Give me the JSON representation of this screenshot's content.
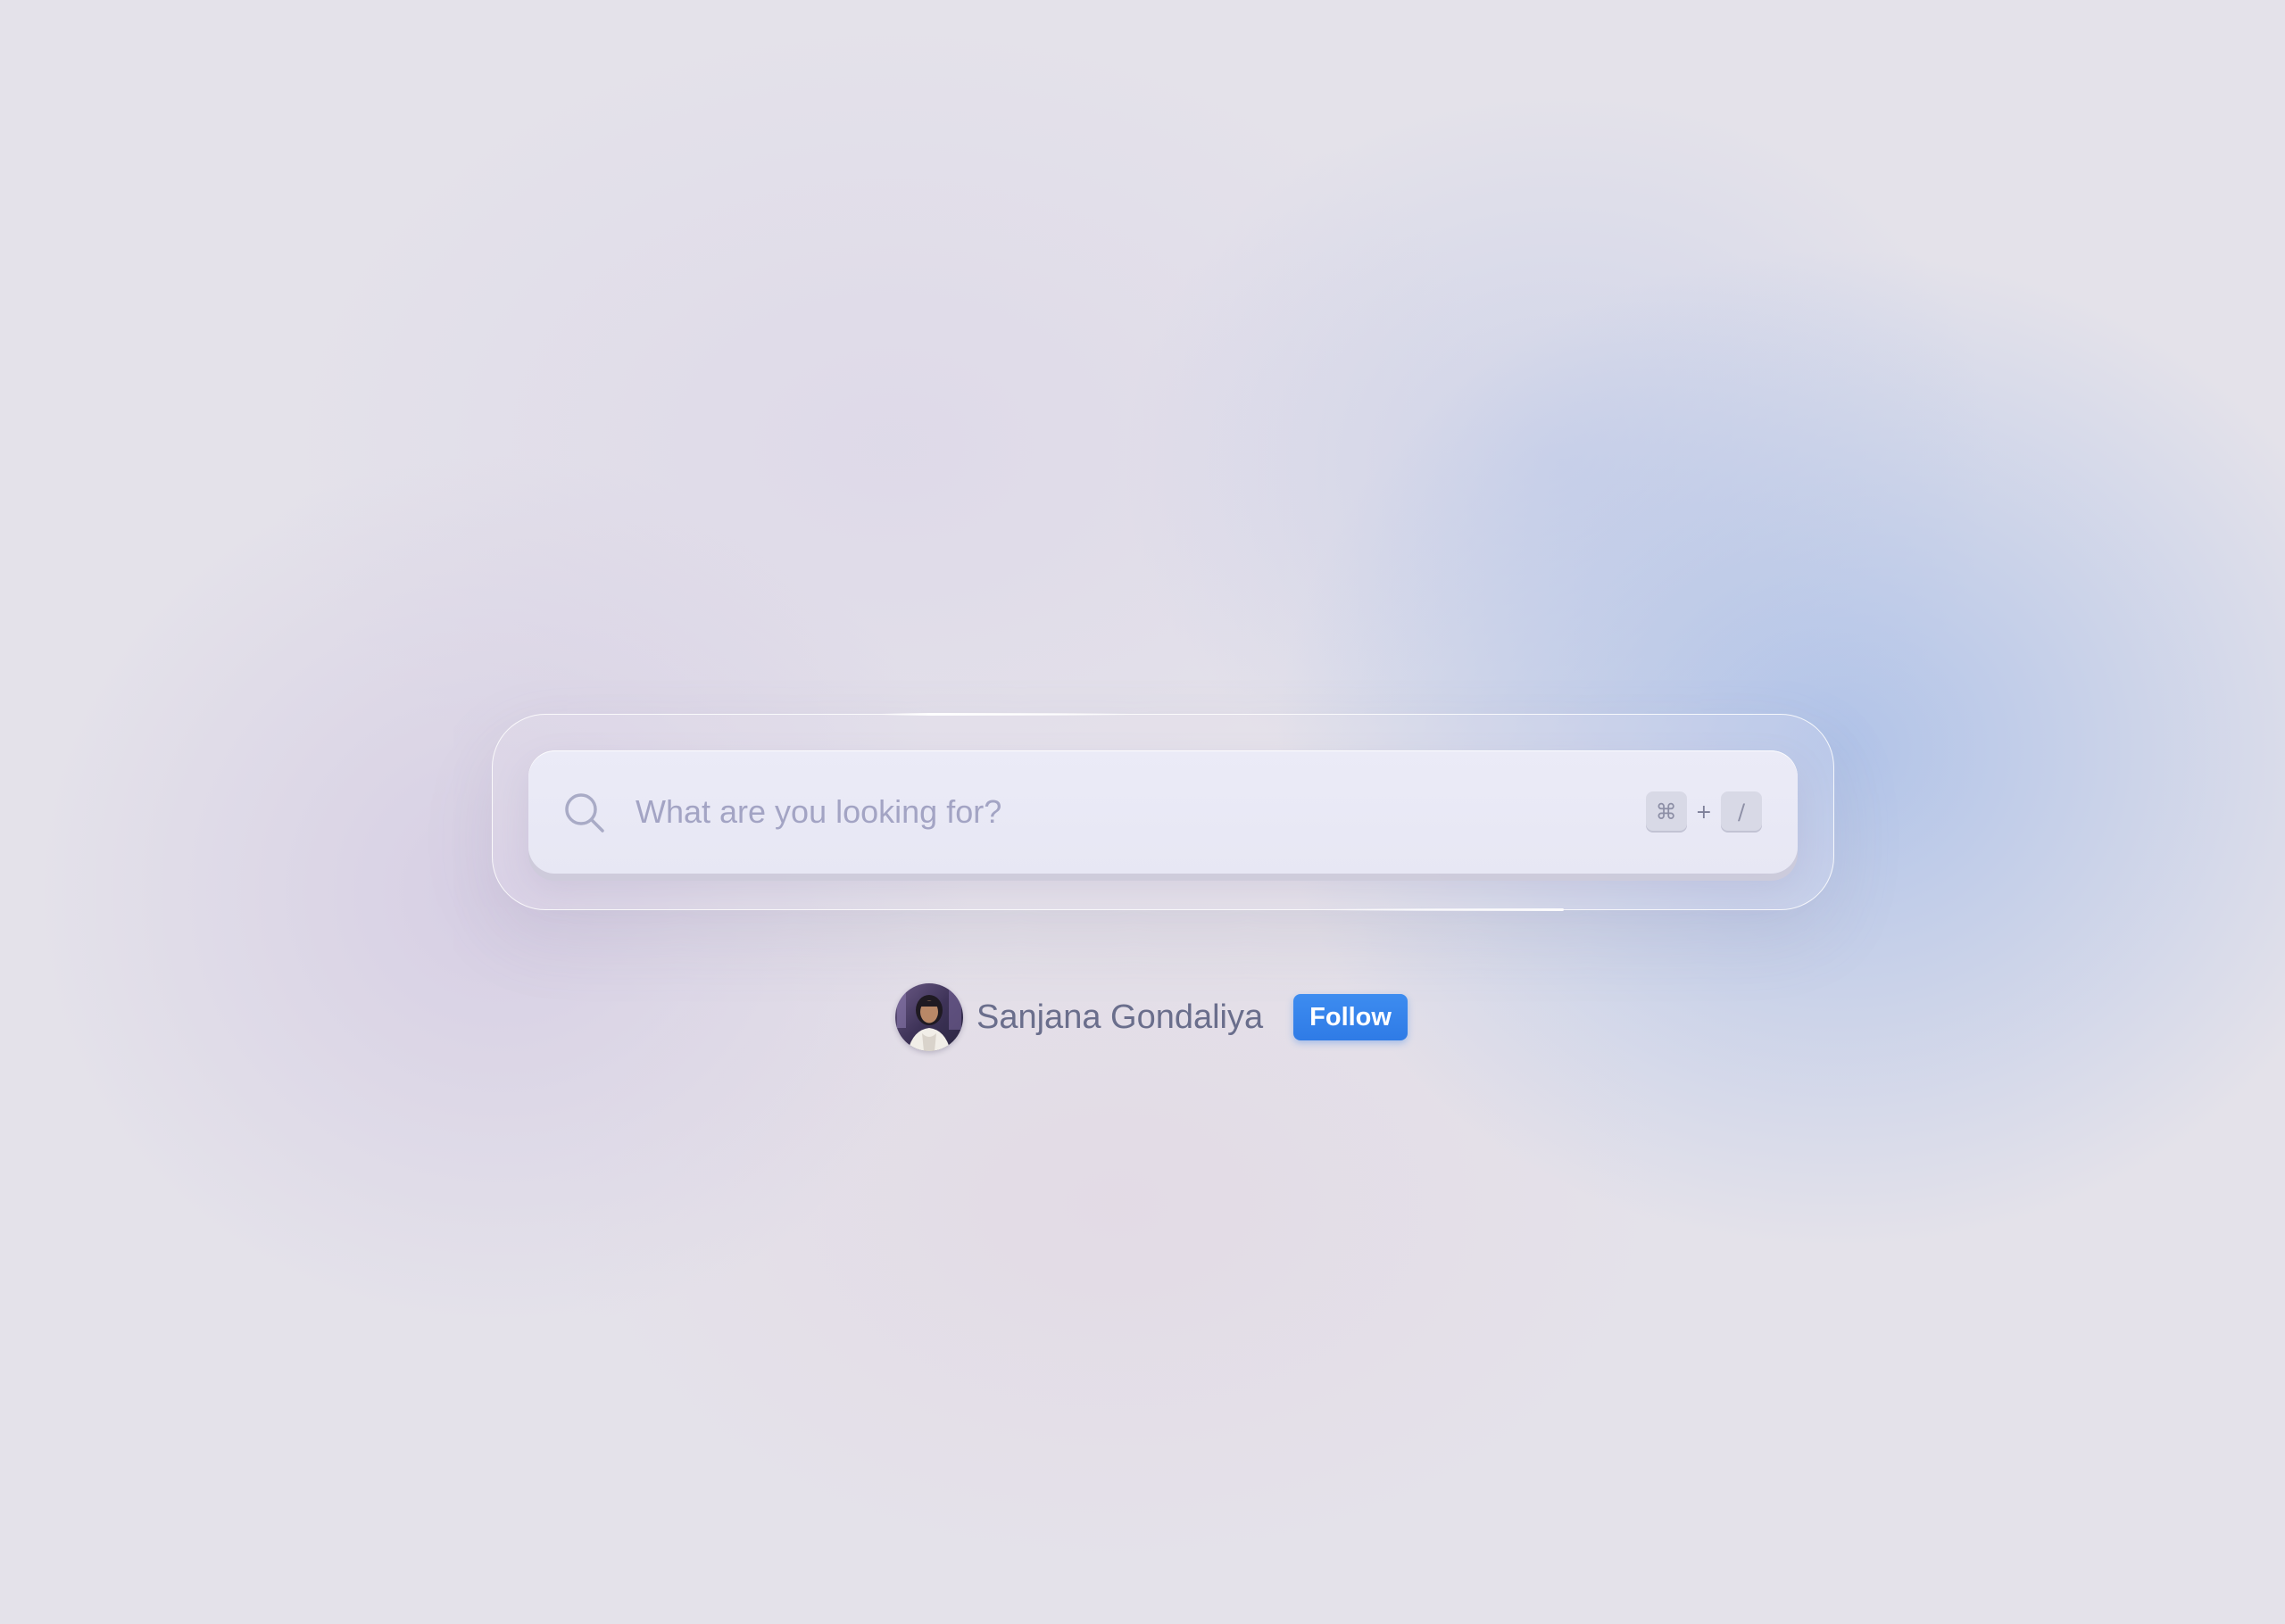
{
  "search": {
    "placeholder": "What are you looking for?",
    "value": "",
    "shortcut": {
      "modifier_key": "⌘",
      "plus": "+",
      "key": "/"
    }
  },
  "author": {
    "name": "Sanjana Gondaliya",
    "follow_label": "Follow"
  },
  "colors": {
    "follow_button": "#2f7be6",
    "search_bar": "#e9e9f6",
    "placeholder": "#a3a4c4",
    "author_name": "#6a6e8c"
  },
  "icons": {
    "search": "search-icon",
    "avatar": "avatar"
  }
}
